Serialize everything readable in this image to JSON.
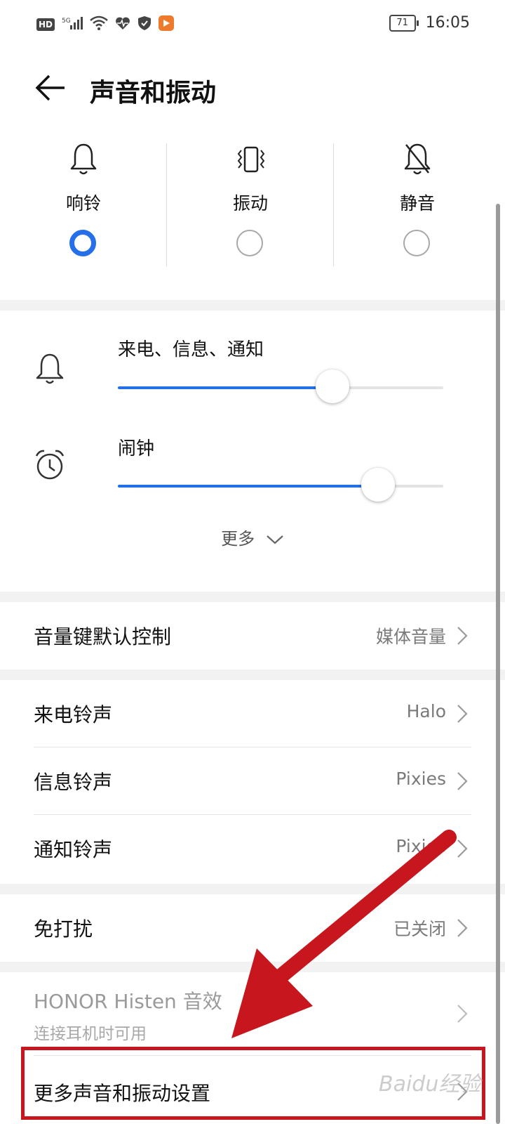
{
  "status_bar": {
    "left_icons": [
      "hd-icon",
      "5g-signal-icon",
      "wifi-icon",
      "health-icon",
      "shield-icon",
      "app-notification-icon"
    ],
    "battery": "71",
    "time": "16:05"
  },
  "header": {
    "title": "声音和振动"
  },
  "modes": [
    {
      "label": "响铃",
      "icon": "bell-icon",
      "selected": true
    },
    {
      "label": "振动",
      "icon": "vibrate-icon",
      "selected": false
    },
    {
      "label": "静音",
      "icon": "bell-off-icon",
      "selected": false
    }
  ],
  "volume": {
    "calls": {
      "label": "来电、信息、通知",
      "icon": "bell-icon",
      "level": 0.66
    },
    "alarm": {
      "label": "闹钟",
      "icon": "alarm-clock-icon",
      "level": 0.8
    },
    "more_label": "更多"
  },
  "volume_key": {
    "label": "音量键默认控制",
    "value": "媒体音量"
  },
  "ringtones": [
    {
      "label": "来电铃声",
      "value": "Halo"
    },
    {
      "label": "信息铃声",
      "value": "Pixies"
    },
    {
      "label": "通知铃声",
      "value": "Pixies"
    }
  ],
  "dnd": {
    "label": "免打扰",
    "value": "已关闭"
  },
  "histen": {
    "label": "HONOR Histen 音效",
    "sublabel": "连接耳机时可用"
  },
  "more_settings": {
    "label": "更多声音和振动设置"
  },
  "watermark": "Baidu经验",
  "colors": {
    "accent": "#256fe8",
    "annotation": "#c8161e"
  }
}
